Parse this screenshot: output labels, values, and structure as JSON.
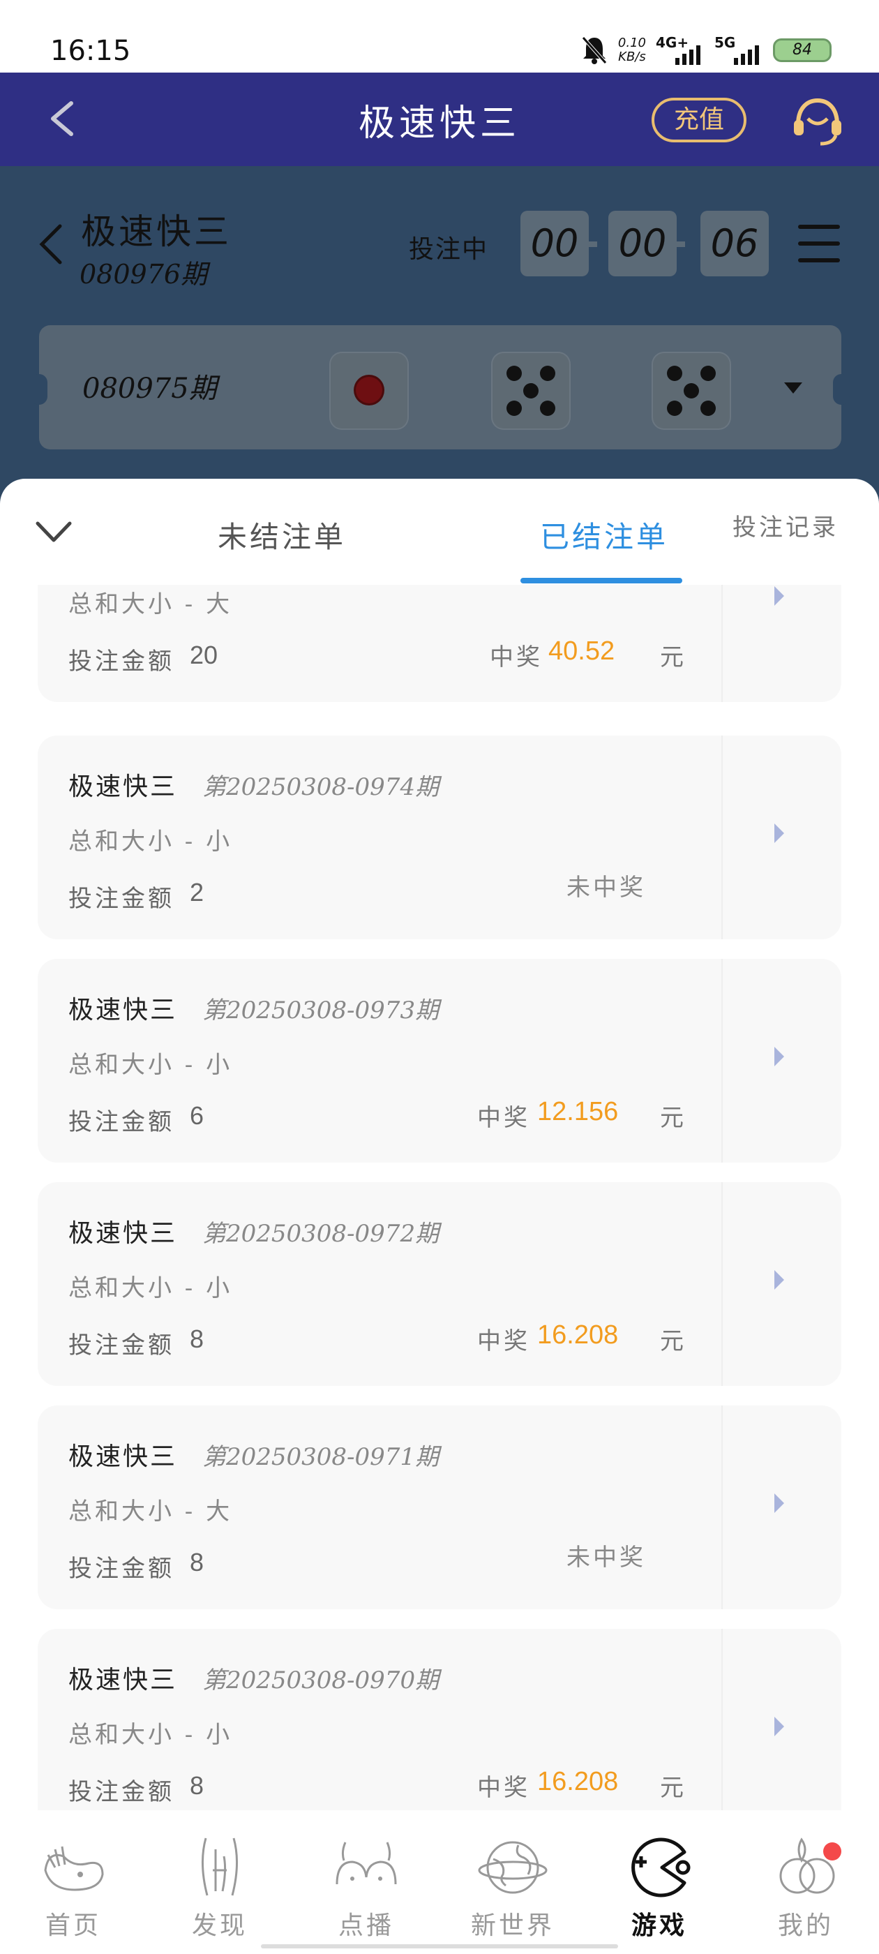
{
  "status": {
    "time": "16:15",
    "speed_value": "0.10",
    "speed_unit": "KB/s",
    "net1": "4G+",
    "net2": "5G",
    "battery": "84"
  },
  "header": {
    "title": "极速快三",
    "recharge_label": "充值"
  },
  "game": {
    "name": "极速快三",
    "current_period": "080976期",
    "state": "投注中",
    "countdown": [
      "00",
      "00",
      "06"
    ],
    "last_period": "080975期",
    "last_dice": [
      1,
      5,
      5
    ]
  },
  "tabs": {
    "unsettled": "未结注单",
    "settled": "已结注单",
    "records": "投注记录"
  },
  "labels": {
    "amount": "投注金额",
    "win": "中奖",
    "unit": "元",
    "lose": "未中奖"
  },
  "orders": [
    {
      "name": "",
      "issue": "",
      "play": "总和大小 - 大",
      "amount": "20",
      "result": "win",
      "prize": "40.52"
    },
    {
      "name": "极速快三",
      "issue": "第20250308-0974期",
      "play": "总和大小 - 小",
      "amount": "2",
      "result": "lose",
      "prize": ""
    },
    {
      "name": "极速快三",
      "issue": "第20250308-0973期",
      "play": "总和大小 - 小",
      "amount": "6",
      "result": "win",
      "prize": "12.156"
    },
    {
      "name": "极速快三",
      "issue": "第20250308-0972期",
      "play": "总和大小 - 小",
      "amount": "8",
      "result": "win",
      "prize": "16.208"
    },
    {
      "name": "极速快三",
      "issue": "第20250308-0971期",
      "play": "总和大小 - 大",
      "amount": "8",
      "result": "lose",
      "prize": ""
    },
    {
      "name": "极速快三",
      "issue": "第20250308-0970期",
      "play": "总和大小 - 小",
      "amount": "8",
      "result": "win",
      "prize": "16.208"
    }
  ],
  "nav": [
    {
      "label": "首页",
      "icon": "home-icon"
    },
    {
      "label": "发现",
      "icon": "discover-icon"
    },
    {
      "label": "点播",
      "icon": "vod-icon"
    },
    {
      "label": "新世界",
      "icon": "planet-icon"
    },
    {
      "label": "游戏",
      "icon": "game-icon",
      "active": true
    },
    {
      "label": "我的",
      "icon": "profile-icon",
      "badge": true
    }
  ],
  "colors": {
    "appbar": "#2f2f84",
    "accent_blue": "#2e8fe0",
    "prize_orange": "#f29c1f",
    "recharge_gold": "#e8bd6f"
  }
}
